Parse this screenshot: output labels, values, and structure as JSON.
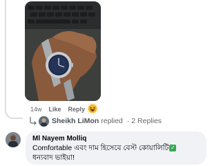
{
  "post": {
    "timestamp": "14w",
    "like_label": "Like",
    "reply_label": "Reply",
    "reaction_icon": "haha-reaction-icon"
  },
  "replies_summary": {
    "name": "Sheikh LiMon",
    "verb": "replied",
    "separator": "·",
    "count_text": "2 Replies"
  },
  "comment": {
    "author": "Ml Nayem Molliq",
    "line1": "Comfortable এবং দাম হিসেবে বেস্ট কোয়ালিটি",
    "badge": "✓",
    "line2": "ধন্যবাদ ভাইয়া!"
  },
  "colors": {
    "bubble": "#f0f2f5",
    "meta_text": "#65676b",
    "check_badge": "#3aa854"
  }
}
